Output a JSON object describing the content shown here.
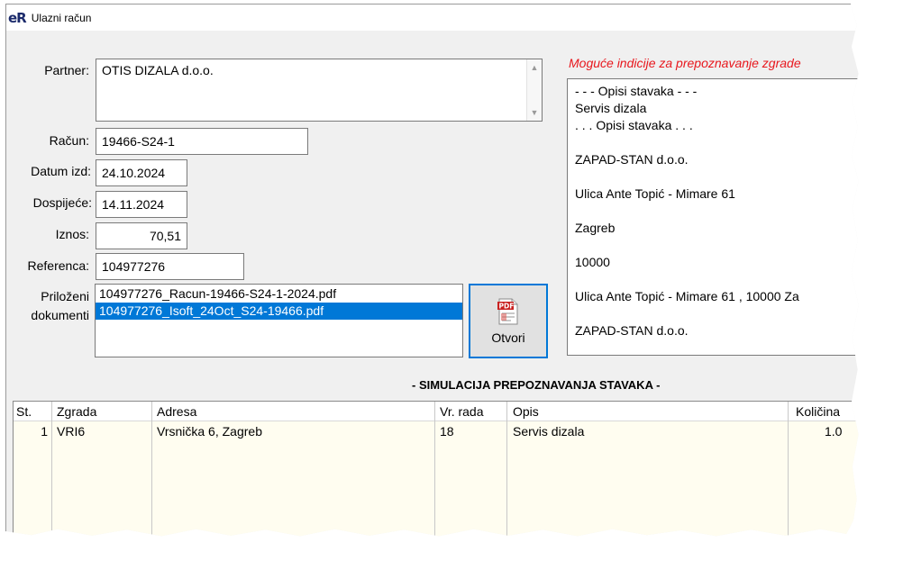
{
  "window": {
    "logo": "eR",
    "title": "Ulazni račun"
  },
  "form": {
    "partner_label": "Partner:",
    "partner_value": "OTIS DIZALA d.o.o.",
    "racun_label": "Račun:",
    "racun_value": "19466-S24-1",
    "datum_label": "Datum izd:",
    "datum_value": "24.10.2024",
    "dospijece_label": "Dospijeće:",
    "dospijece_value": "14.11.2024",
    "iznos_label": "Iznos:",
    "iznos_value": "70,51",
    "referenca_label": "Referenca:",
    "referenca_value": "104977276",
    "prilozeni_label_1": "Priloženi",
    "prilozeni_label_2": "dokumenti"
  },
  "attachments": [
    {
      "name": "104977276_Racun-19466-S24-1-2024.pdf",
      "selected": false
    },
    {
      "name": "104977276_Isoft_24Oct_S24-19466.pdf",
      "selected": true
    }
  ],
  "open_button": {
    "label": "Otvori",
    "icon": "pdf-icon"
  },
  "hints": {
    "title": "Moguće indicije za prepoznavanje zgrade",
    "lines": [
      "- - - Opisi stavaka - - -",
      "Servis dizala",
      ". . . Opisi stavaka . . .",
      "ZAPAD-STAN d.o.o.",
      "Ulica Ante Topić - Mimare 61",
      "Zagreb",
      "10000",
      "Ulica Ante Topić - Mimare 61 , 10000 Za",
      "ZAPAD-STAN d.o.o."
    ]
  },
  "simulation": {
    "title": "- SIMULACIJA PREPOZNAVANJA STAVAKA -",
    "columns": [
      "St.",
      "Zgrada",
      "Adresa",
      "Vr. rada",
      "Opis",
      "Količina"
    ],
    "rows": [
      {
        "st": "1",
        "zgrada": "VRI6",
        "adresa": "Vrsnička 6, Zagreb",
        "vr_rada": "18",
        "opis": "Servis dizala",
        "kolicina": "1.0"
      }
    ]
  },
  "colors": {
    "accent": "#0078d7",
    "hint_title": "#e8181e",
    "grid_bg": "#fffdf0"
  }
}
